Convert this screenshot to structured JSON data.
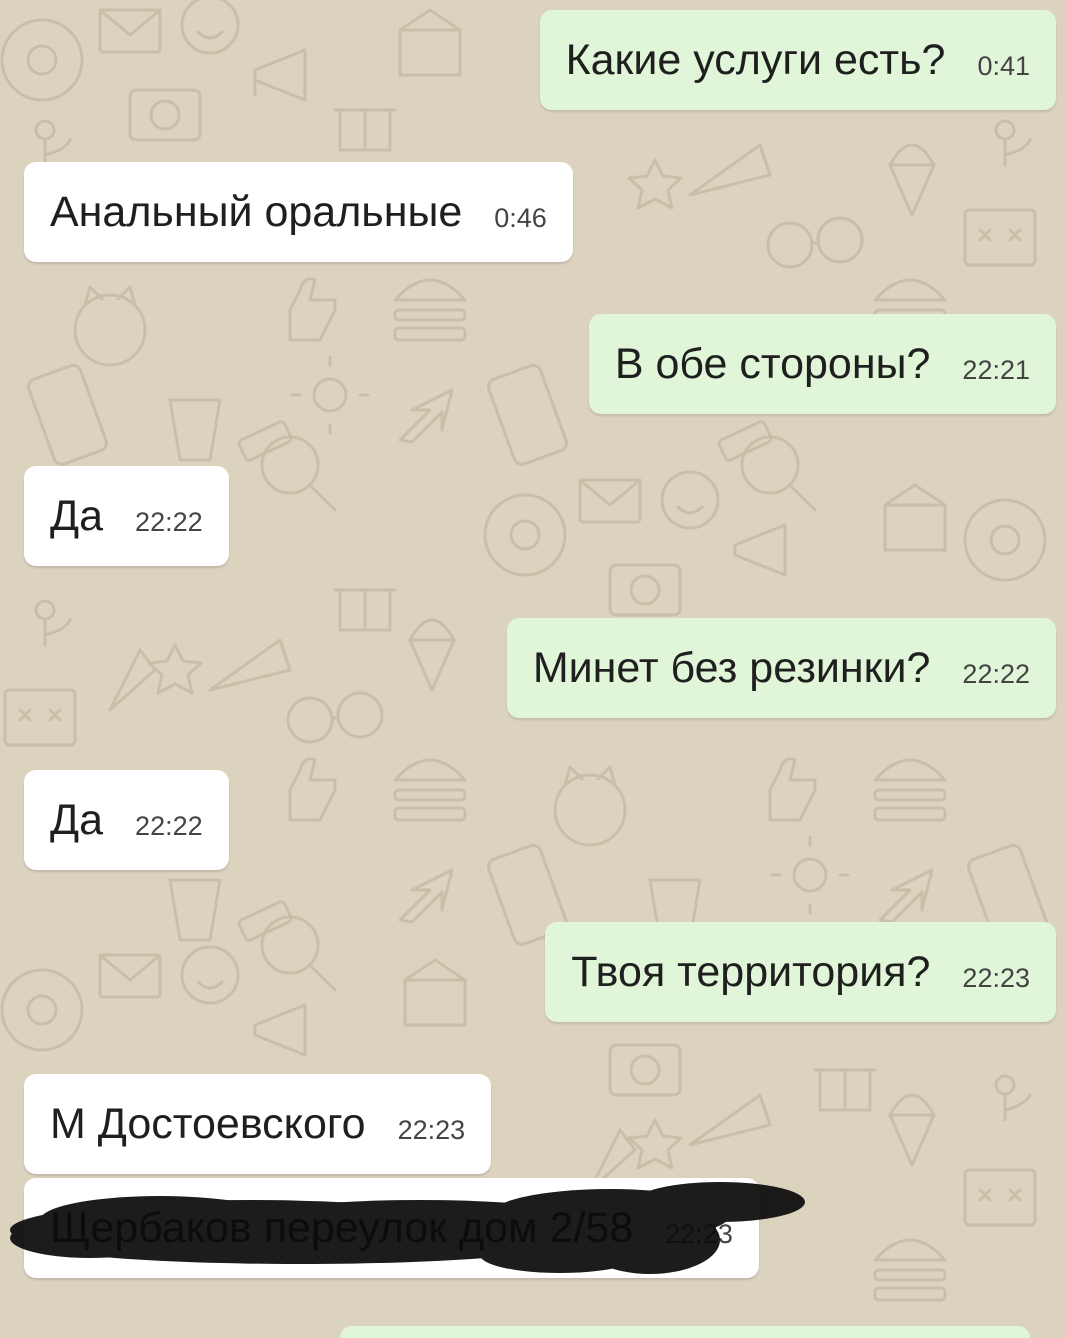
{
  "colors": {
    "wallpaper": "#dcd3bf",
    "outgoing_bubble": "#e1f6d9",
    "incoming_bubble": "#ffffff",
    "text": "#1f1f1f",
    "scribble": "#0b0b0b"
  },
  "messages": [
    {
      "direction": "outgoing",
      "text": "Какие услуги есть?",
      "time": "0:41"
    },
    {
      "direction": "incoming",
      "text": "Анальный оральные",
      "time": "0:46"
    },
    {
      "direction": "outgoing",
      "text": "В обе стороны?",
      "time": "22:21"
    },
    {
      "direction": "incoming",
      "text": "Да",
      "time": "22:22"
    },
    {
      "direction": "outgoing",
      "text": "Минет без резинки?",
      "time": "22:22"
    },
    {
      "direction": "incoming",
      "text": "Да",
      "time": "22:22"
    },
    {
      "direction": "outgoing",
      "text": "Твоя территория?",
      "time": "22:23"
    },
    {
      "direction": "incoming",
      "text": "М Достоевского",
      "time": "22:23"
    },
    {
      "direction": "incoming",
      "text": "Щербаков переулок дом 2/58",
      "time": "22:23",
      "redacted": true
    }
  ]
}
